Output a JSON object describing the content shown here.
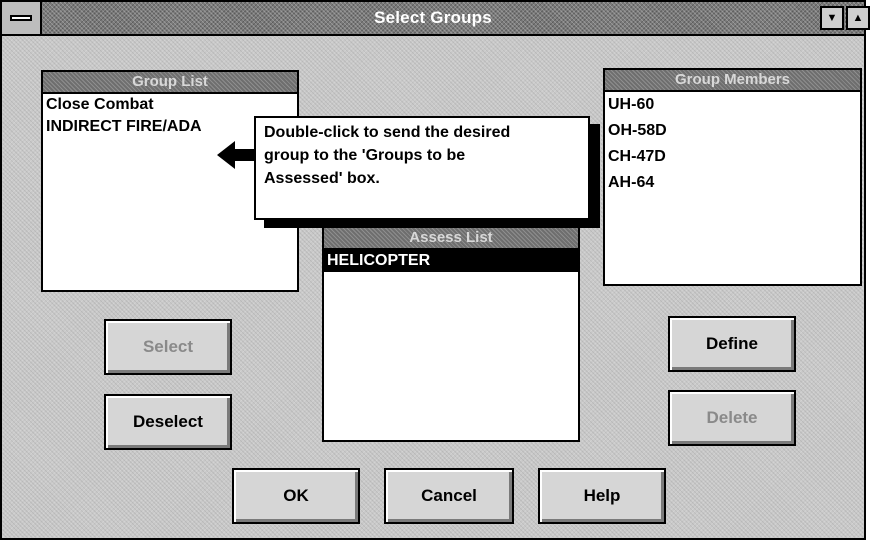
{
  "window": {
    "title": "Select Groups",
    "controls": {
      "minimize_symbol": "▼",
      "maximize_symbol": "▲",
      "system_menu_icon": "system-menu-icon"
    }
  },
  "group_list": {
    "caption": "Group List",
    "items": [
      "Close Combat",
      "INDIRECT FIRE/ADA"
    ]
  },
  "group_members": {
    "caption": "Group Members",
    "items": [
      "UH-60",
      "OH-58D",
      "CH-47D",
      "AH-64"
    ]
  },
  "assess_list": {
    "caption": "Assess List",
    "items": [
      "HELICOPTER"
    ],
    "selected_index": 0
  },
  "tooltip": {
    "lines": [
      "Double-click to send the desired",
      "group to the 'Groups to be",
      "Assessed' box."
    ]
  },
  "buttons": {
    "select": "Select",
    "deselect": "Deselect",
    "define": "Define",
    "delete": "Delete",
    "ok": "OK",
    "cancel": "Cancel",
    "help": "Help"
  },
  "button_states": {
    "select": "disabled",
    "delete": "disabled"
  }
}
